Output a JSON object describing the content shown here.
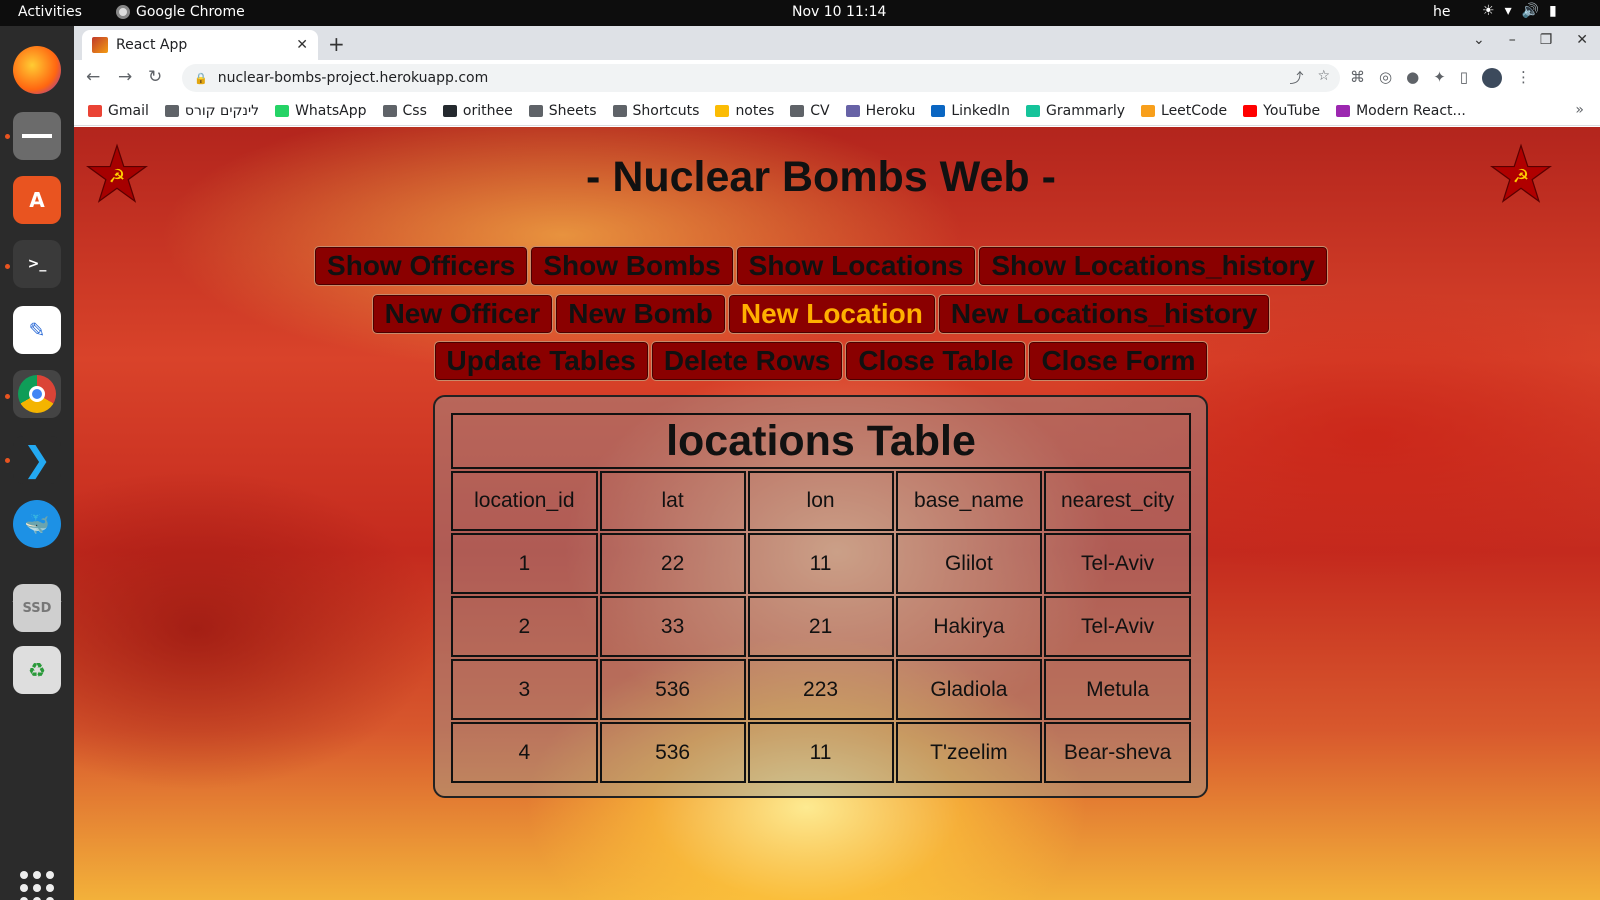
{
  "os": {
    "activities": "Activities",
    "app_name": "Google Chrome",
    "clock": "Nov 10  11:14",
    "language": "he"
  },
  "browser": {
    "tab_title": "React App",
    "url": "nuclear-bombs-project.herokuapp.com",
    "bookmarks": [
      "Gmail",
      "לינקים קורס",
      "WhatsApp",
      "Css",
      "orithee",
      "Sheets",
      "Shortcuts",
      "notes",
      "CV",
      "Heroku",
      "LinkedIn",
      "Grammarly",
      "LeetCode",
      "YouTube",
      "Modern React..."
    ],
    "bookmark_more": "»"
  },
  "page": {
    "title": "- Nuclear Bombs Web -",
    "row1": [
      "Show Officers",
      "Show Bombs",
      "Show Locations",
      "Show Locations_history"
    ],
    "row2": [
      "New Officer",
      "New Bomb",
      "New Location",
      "New Locations_history"
    ],
    "row3": [
      "Update Tables",
      "Delete Rows",
      "Close Table",
      "Close Form"
    ],
    "active_button": "New Location",
    "active_color": "#ffb000",
    "button_color": "#8a0000"
  },
  "table": {
    "caption": "locations Table",
    "columns": [
      "location_id",
      "lat",
      "lon",
      "base_name",
      "nearest_city"
    ],
    "rows": [
      [
        "1",
        "22",
        "11",
        "Glilot",
        "Tel-Aviv"
      ],
      [
        "2",
        "33",
        "21",
        "Hakirya",
        "Tel-Aviv"
      ],
      [
        "3",
        "536",
        "223",
        "Gladiola",
        "Metula"
      ],
      [
        "4",
        "536",
        "11",
        "T'zeelim",
        "Bear-sheva"
      ]
    ]
  }
}
